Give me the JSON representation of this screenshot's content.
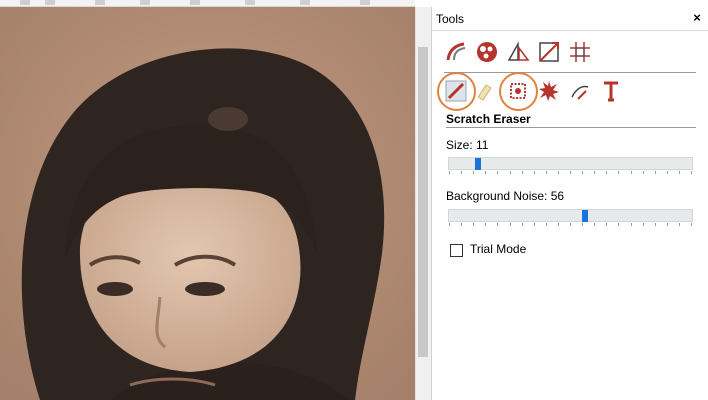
{
  "panel": {
    "title": "Tools",
    "close_glyph": "×"
  },
  "tools_row1": [
    "brush-curve-icon",
    "color-wheel-icon",
    "perspective-icon",
    "crop-resize-icon",
    "grid-icon"
  ],
  "tools_row2": [
    "scratch-eraser-icon",
    "eraser-icon",
    "noise-reduction-icon",
    "red-splash-icon",
    "lasso-hand-icon",
    "text-tool-icon"
  ],
  "section": {
    "title": "Scratch Eraser"
  },
  "size": {
    "label": "Size: 11",
    "value": 11
  },
  "noise": {
    "label": "Background Noise: 56",
    "value": 56
  },
  "trial_mode": {
    "label": "Trial Mode",
    "checked": false
  },
  "colors": {
    "highlight": "#e0823c",
    "slider_thumb": "#1a73d9",
    "tool_red": "#b5342c"
  }
}
